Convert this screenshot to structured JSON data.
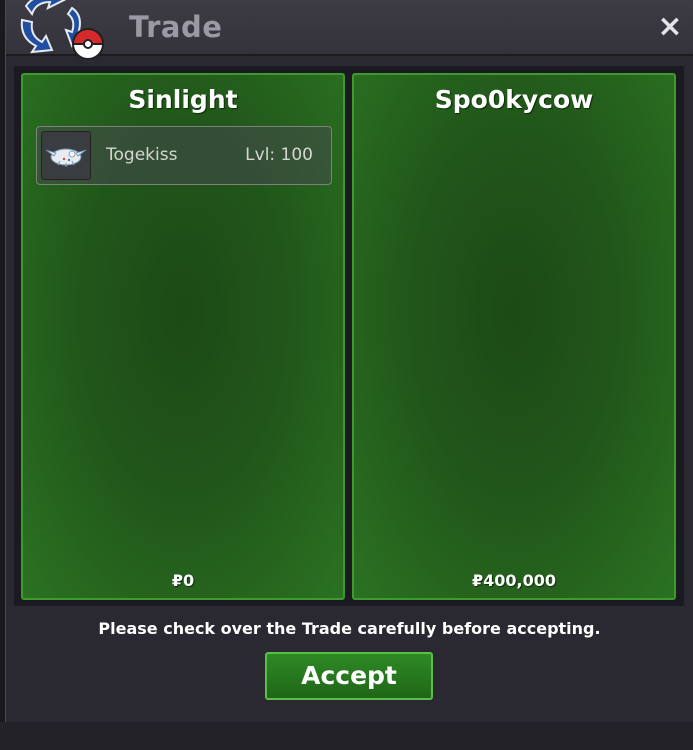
{
  "window": {
    "title": "Trade",
    "close_label": "×"
  },
  "logo": {
    "icon": "trade-arrows-pokeball-icon"
  },
  "left_panel": {
    "name": "Sinlight",
    "items": [
      {
        "name": "Togekiss",
        "level": "Lvl: 100",
        "icon": "togekiss-icon"
      }
    ],
    "money": "₽0"
  },
  "right_panel": {
    "name": "Spo0kycow",
    "money": "₽400,000"
  },
  "notice": "Please check over the Trade carefully before accepting.",
  "accept_label": "Accept",
  "colors": {
    "panel_border": "#3f9a2e",
    "panel_fill": "#21561a",
    "button_fill": "#2e8a25",
    "window_bg": "#2a2932"
  }
}
